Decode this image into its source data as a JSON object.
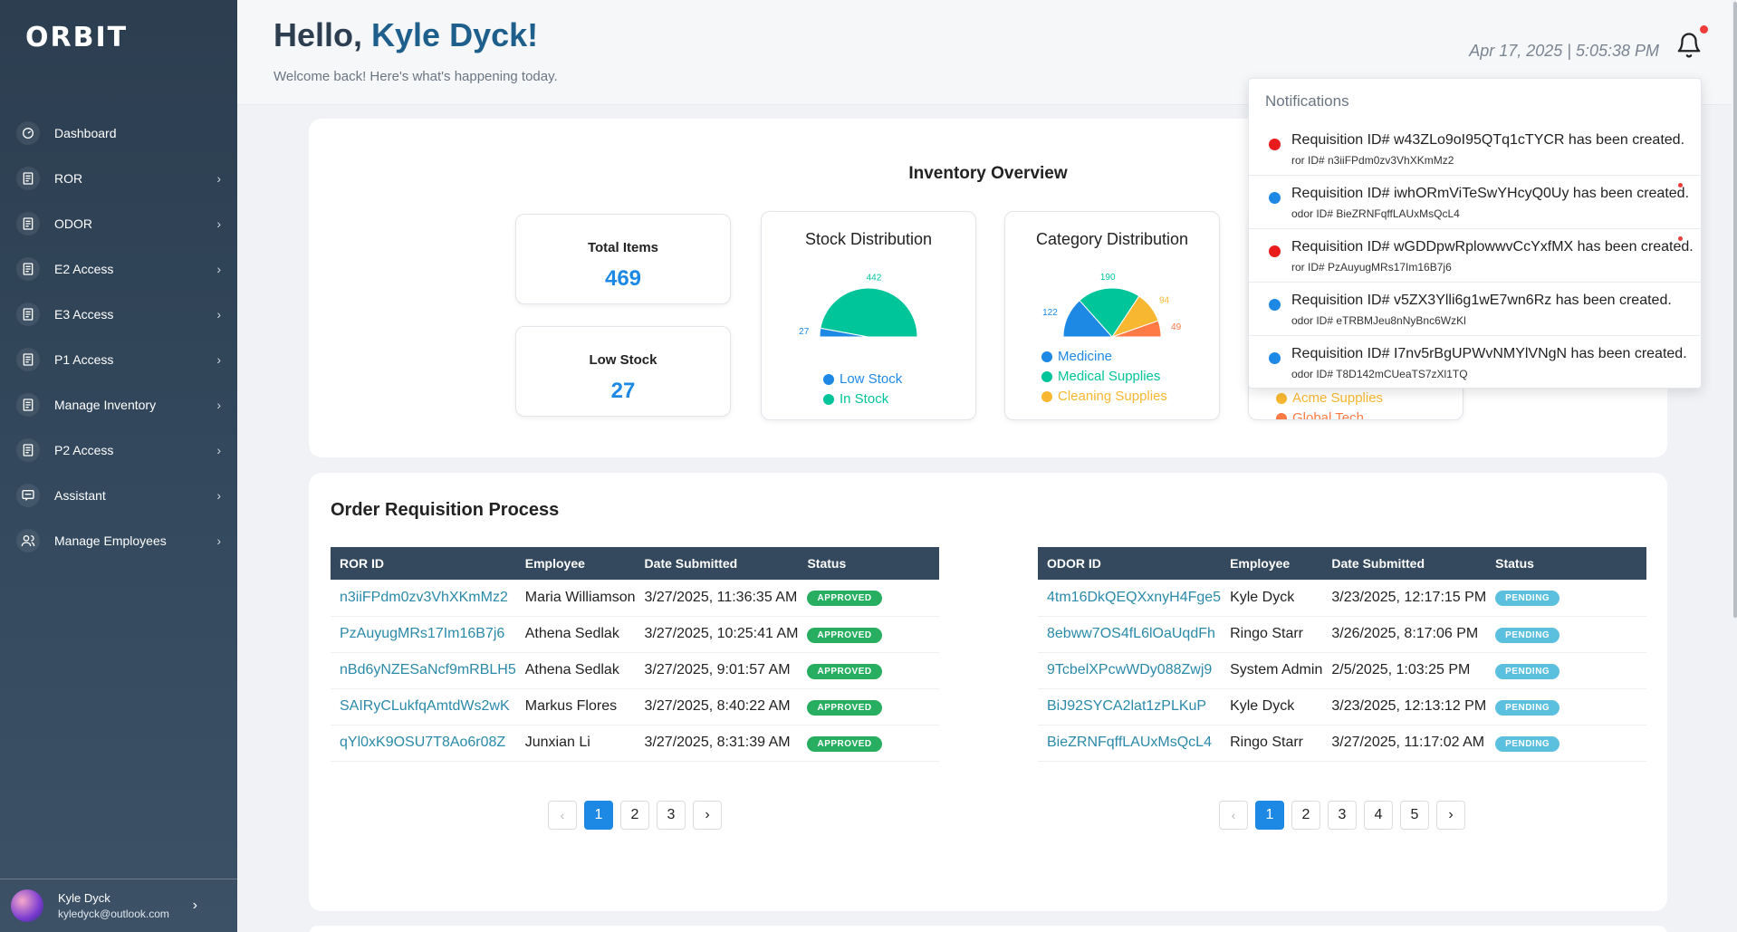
{
  "brand": {
    "logo_text": "ORBIT"
  },
  "sidebar": {
    "items": [
      {
        "label": "Dashboard",
        "icon": "dashboard-icon",
        "chevron": false
      },
      {
        "label": "ROR",
        "icon": "document-icon",
        "chevron": true
      },
      {
        "label": "ODOR",
        "icon": "document-icon",
        "chevron": true
      },
      {
        "label": "E2 Access",
        "icon": "document-icon",
        "chevron": true
      },
      {
        "label": "E3 Access",
        "icon": "document-icon",
        "chevron": true
      },
      {
        "label": "P1 Access",
        "icon": "document-icon",
        "chevron": true
      },
      {
        "label": "Manage Inventory",
        "icon": "document-icon",
        "chevron": true
      },
      {
        "label": "P2 Access",
        "icon": "document-icon",
        "chevron": true
      },
      {
        "label": "Assistant",
        "icon": "chat-icon",
        "chevron": true
      },
      {
        "label": "Manage Employees",
        "icon": "users-icon",
        "chevron": true
      }
    ],
    "user": {
      "name": "Kyle Dyck",
      "email": "kyledyck@outlook.com"
    }
  },
  "header": {
    "greeting_prefix": "Hello, ",
    "greeting_name": "Kyle Dyck!",
    "welcome": "Welcome back! Here's what's happening today.",
    "datetime": "Apr 17, 2025 | 5:05:38 PM"
  },
  "inventory": {
    "title": "Inventory Overview",
    "total_items_label": "Total Items",
    "total_items_value": "469",
    "low_stock_label": "Low Stock",
    "low_stock_value": "27",
    "stock_distribution": {
      "title": "Stock Distribution",
      "labels": [
        "442",
        "27"
      ],
      "legend": [
        "Low Stock",
        "In Stock"
      ]
    },
    "category_distribution": {
      "title": "Category Distribution",
      "labels": [
        "190",
        "122",
        "94",
        "49"
      ],
      "legend": [
        "Medicine",
        "Medical Supplies",
        "Cleaning Supplies"
      ]
    },
    "supplier_legend": [
      "Acme Supplies",
      "Global Tech"
    ]
  },
  "chart_data": [
    {
      "type": "pie",
      "title": "Stock Distribution",
      "categories": [
        "Low Stock",
        "In Stock"
      ],
      "values": [
        27,
        442
      ]
    },
    {
      "type": "pie",
      "title": "Category Distribution",
      "categories": [
        "Medicine",
        "Medical Supplies",
        "Cleaning Supplies",
        ""
      ],
      "values": [
        122,
        190,
        94,
        49
      ]
    }
  ],
  "requisitions": {
    "title": "Order Requisition Process",
    "ror": {
      "headers": [
        "ROR ID",
        "Employee",
        "Date Submitted",
        "Status"
      ],
      "rows": [
        [
          "n3iiFPdm0zv3VhXKmMz2",
          "Maria Williamson",
          "3/27/2025, 11:36:35 AM",
          "APPROVED"
        ],
        [
          "PzAuyugMRs17Im16B7j6",
          "Athena Sedlak",
          "3/27/2025, 10:25:41 AM",
          "APPROVED"
        ],
        [
          "nBd6yNZESaNcf9mRBLH5",
          "Athena Sedlak",
          "3/27/2025, 9:01:57 AM",
          "APPROVED"
        ],
        [
          "SAIRyCLukfqAmtdWs2wK",
          "Markus Flores",
          "3/27/2025, 8:40:22 AM",
          "APPROVED"
        ],
        [
          "qYl0xK9OSU7T8Ao6r08Z",
          "Junxian Li",
          "3/27/2025, 8:31:39 AM",
          "APPROVED"
        ]
      ],
      "pages": [
        "1",
        "2",
        "3"
      ]
    },
    "odor": {
      "headers": [
        "ODOR ID",
        "Employee",
        "Date Submitted",
        "Status"
      ],
      "rows": [
        [
          "4tm16DkQEQXxnyH4Fge5",
          "Kyle Dyck",
          "3/23/2025, 12:17:15 PM",
          "PENDING"
        ],
        [
          "8ebww7OS4fL6lOaUqdFh",
          "Ringo Starr",
          "3/26/2025, 8:17:06 PM",
          "PENDING"
        ],
        [
          "9TcbelXPcwWDy088Zwj9",
          "System Admin",
          "2/5/2025, 1:03:25 PM",
          "PENDING"
        ],
        [
          "BiJ92SYCA2lat1zPLKuP",
          "Kyle Dyck",
          "3/23/2025, 12:13:12 PM",
          "PENDING"
        ],
        [
          "BieZRNFqffLAUxMsQcL4",
          "Ringo Starr",
          "3/27/2025, 11:17:02 AM",
          "PENDING"
        ]
      ],
      "pages": [
        "1",
        "2",
        "3",
        "4",
        "5"
      ]
    }
  },
  "notifications": {
    "title": "Notifications",
    "items": [
      {
        "text": "Requisition ID# w43ZLo9oI95QTq1cTYCR has been created.",
        "sub": "ror ID# n3iiFPdm0zv3VhXKmMz2",
        "dot_color": "#e81c1c",
        "unread": false
      },
      {
        "text": "Requisition ID# iwhORmViTeSwYHcyQ0Uy has been created.",
        "sub": "odor ID# BieZRNFqffLAUxMsQcL4",
        "dot_color": "#1e88e5",
        "unread": true
      },
      {
        "text": "Requisition ID# wGDDpwRplowwvCcYxfMX has been created.",
        "sub": "ror ID# PzAuyugMRs17Im16B7j6",
        "dot_color": "#e81c1c",
        "unread": true
      },
      {
        "text": "Requisition ID# v5ZX3Ylli6g1wE7wn6Rz has been created.",
        "sub": "odor ID# eTRBMJeu8nNyBnc6WzKl",
        "dot_color": "#1e88e5",
        "unread": false
      },
      {
        "text": "Requisition ID# I7nv5rBgUPWvNMYlVNgN has been created.",
        "sub": "odor ID# T8D142mCUeaTS7zXl1TQ",
        "dot_color": "#1e88e5",
        "unread": false
      }
    ]
  },
  "colors": {
    "sidebar": "#2c3e50",
    "accent": "#1e88e5",
    "teal": "#00c49a",
    "amber": "#f7b731",
    "orange": "#ff7a45",
    "approved": "#27ae60",
    "pending": "#5bc0de"
  }
}
